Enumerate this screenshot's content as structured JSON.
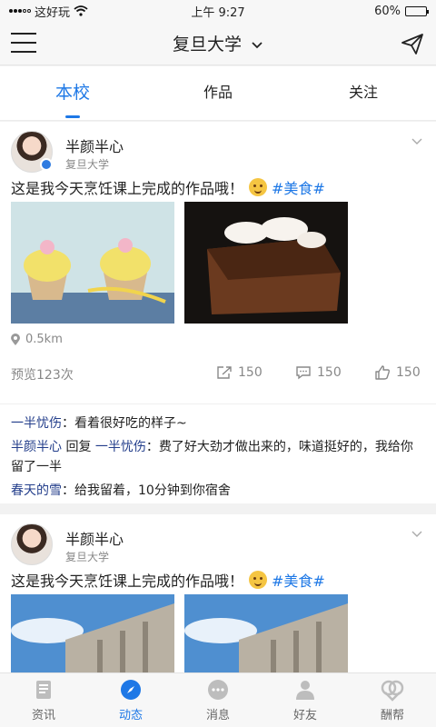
{
  "status": {
    "carrier": "这好玩",
    "time": "上午 9:27",
    "battery": "60%",
    "battery_level": 0.6
  },
  "nav": {
    "title": "复旦大学"
  },
  "tabs": [
    {
      "label": "本校",
      "active": true
    },
    {
      "label": "作品",
      "active": false
    },
    {
      "label": "关注",
      "active": false
    }
  ],
  "posts": [
    {
      "user": "半颜半心",
      "school": "复旦大学",
      "text": "这是我今天烹饪课上完成的作品哦！",
      "hashtag": "#美食#",
      "distance": "0.5km",
      "views": "预览123次",
      "shares": "150",
      "comments_count": "150",
      "likes": "150",
      "comments": [
        {
          "name": "一半忧伤",
          "sep": "：",
          "text": "看着很好吃的样子~"
        },
        {
          "name": "半颜半心",
          "reply_word": " 回复 ",
          "reply_to": "一半忧伤",
          "sep": "：",
          "text": "费了好大劲才做出来的，味道挺好的，我给你留了一半"
        },
        {
          "name": "春天的雪",
          "sep": "：",
          "text": "给我留着，10分钟到你宿舍"
        }
      ]
    },
    {
      "user": "半颜半心",
      "school": "复旦大学",
      "text": "这是我今天烹饪课上完成的作品哦！",
      "hashtag": "#美食#"
    }
  ],
  "bottom_nav": [
    {
      "label": "资讯",
      "icon": "news-icon",
      "active": false
    },
    {
      "label": "动态",
      "icon": "compass-icon",
      "active": true
    },
    {
      "label": "消息",
      "icon": "message-icon",
      "active": false
    },
    {
      "label": "好友",
      "icon": "friend-icon",
      "active": false
    },
    {
      "label": "酬帮",
      "icon": "help-icon",
      "active": false
    }
  ],
  "colors": {
    "accent": "#1e78e6",
    "comment_name": "#233e8b"
  }
}
